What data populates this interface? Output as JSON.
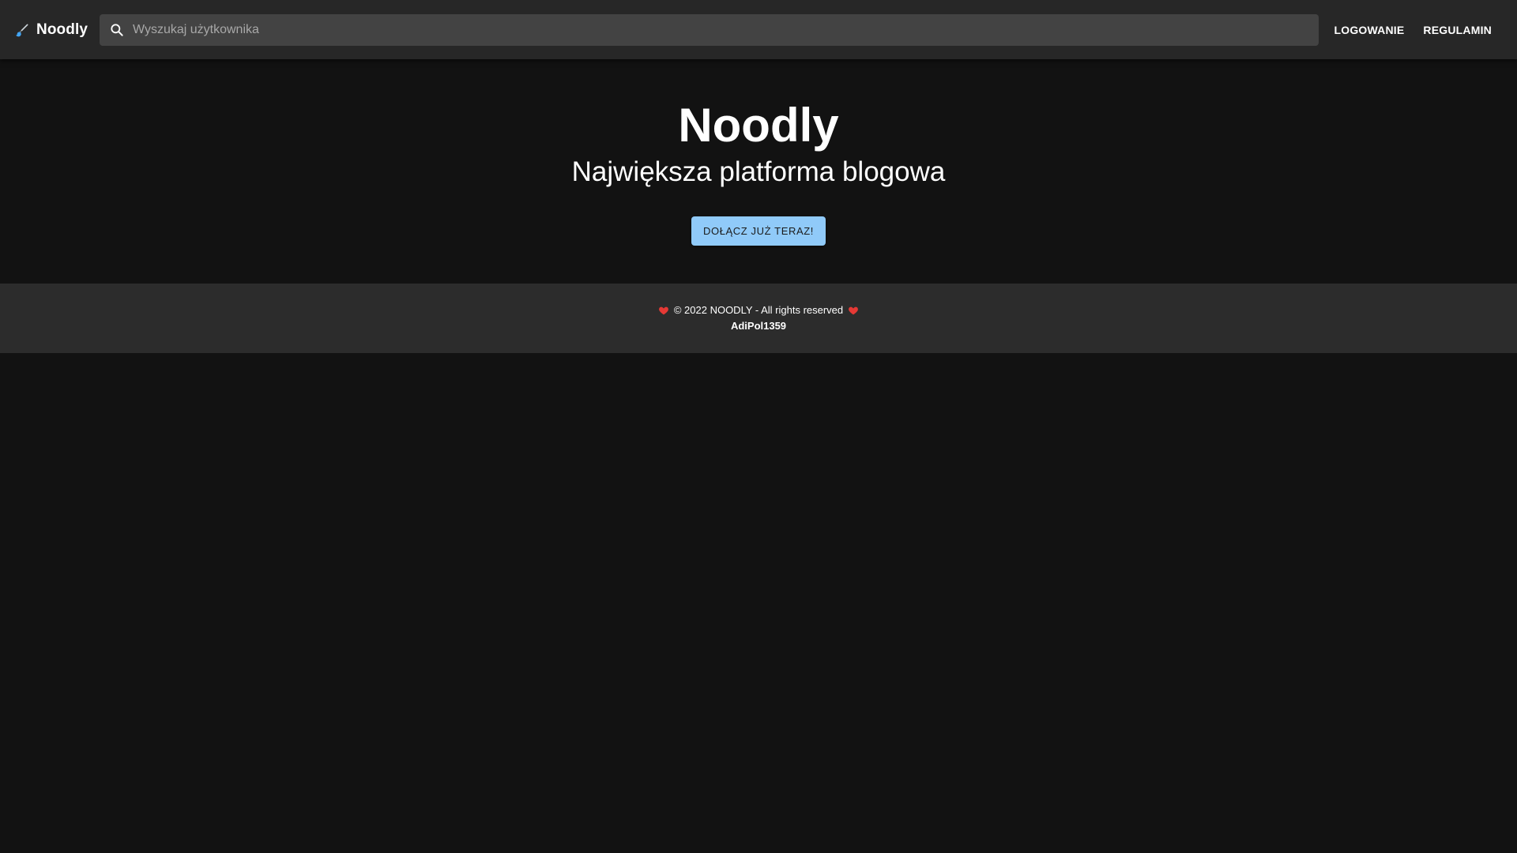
{
  "header": {
    "brand_icon": "brush-icon",
    "brand_name": "Noodly",
    "search": {
      "icon": "search-icon",
      "placeholder": "Wyszukaj użytkownika",
      "value": ""
    },
    "nav": [
      {
        "label": "LOGOWANIE"
      },
      {
        "label": "REGULAMIN"
      }
    ]
  },
  "hero": {
    "title": "Noodly",
    "subtitle": "Największa platforma blogowa",
    "cta_label": "DOŁĄCZ JUŻ TERAZ!"
  },
  "footer": {
    "copyright": "© 2022 NOODLY - All rights reserved",
    "author": "AdiPol1359",
    "heart_icon": "heart-icon"
  },
  "colors": {
    "background": "#121212",
    "appbar": "#272727",
    "search_field": "#434343",
    "cta": "#90caf9",
    "footer": "#2c2c2c",
    "heart": "#e53935"
  }
}
